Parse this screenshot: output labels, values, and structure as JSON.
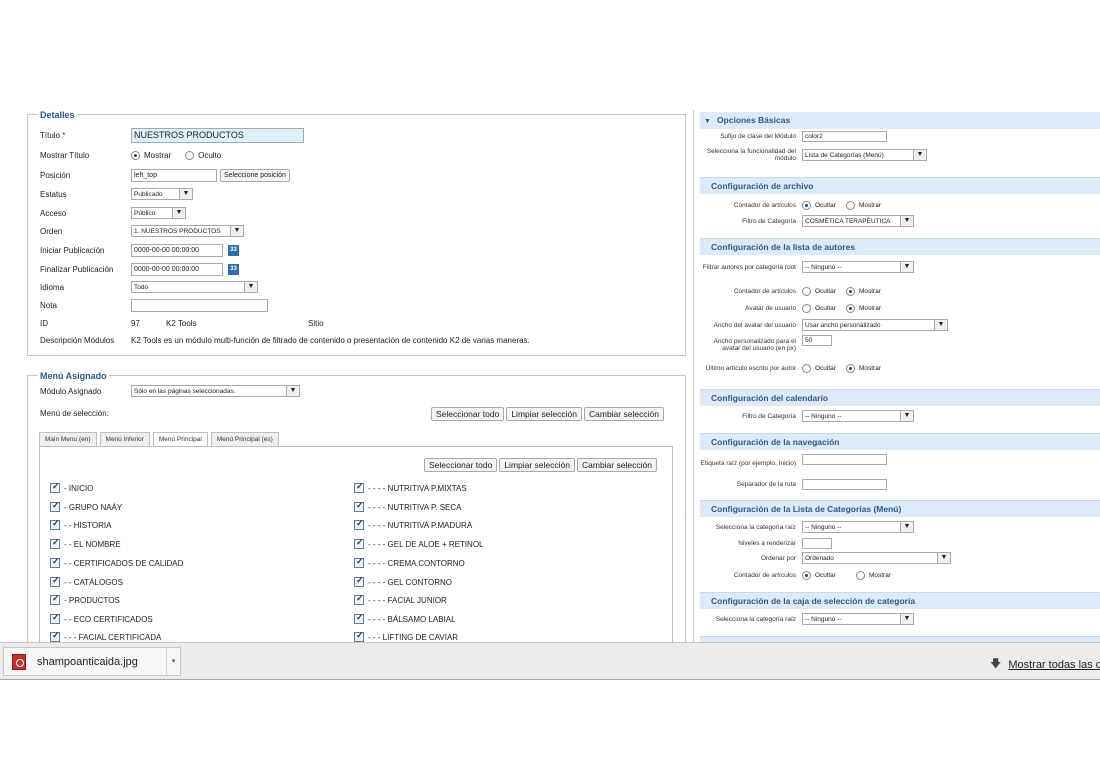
{
  "details": {
    "legend": "Detalles",
    "titulo_label": "Título",
    "titulo_req": "*",
    "titulo_value": "NUESTROS PRODUCTOS",
    "mostrar_titulo_label": "Mostrar Título",
    "mostrar_opt": "Mostrar",
    "oculto_opt": "Oculto",
    "posicion_label": "Posición",
    "posicion_value": "left_top",
    "posicion_button": "Seleccione posición",
    "estatus_label": "Estatus",
    "estatus_value": "Publicado",
    "acceso_label": "Acceso",
    "acceso_value": "Público",
    "orden_label": "Orden",
    "orden_value": "1. NUESTROS PRODUCTOS",
    "iniciar_label": "Iniciar Publicación",
    "iniciar_value": "0000-00-00 00:00:00",
    "finalizar_label": "Finalizar Publicación",
    "finalizar_value": "0000-00-00 00:00:00",
    "cal_icon_text": "33",
    "idioma_label": "Idioma",
    "idioma_value": "Todo",
    "nota_label": "Nota",
    "nota_value": "",
    "id_label": "ID",
    "id_value": "97",
    "module_type": "K2 Tools",
    "site": "Sitio",
    "desc_label": "Descripción Módulos",
    "desc_value": "K2 Tools es un módulo multi-función de filtrado de contenido o presentación de contenido K2 de varias maneras."
  },
  "menu": {
    "legend": "Menú Asignado",
    "modulo_label": "Módulo Asignado",
    "modulo_value": "Sólo en las páginas seleccionadas.",
    "seleccion_label": "Menú de selección:",
    "buttons": [
      "Seleccionar todo",
      "Limpiar selección",
      "Cambiar selección"
    ],
    "tabs": [
      "Main Menu (en)",
      "Menú Inferior",
      "Menú Principal",
      "Menú Principal (es)"
    ],
    "left_items": [
      "- INICIO",
      "- GRUPO NAÁY",
      "- - HISTORIA",
      "- - EL NOMBRE",
      "- - CERTIFICADOS DE CALIDAD",
      "- - CATÁLOGOS",
      "- PRODUCTOS",
      "- - ECO CERTIFICADOS",
      "- - - FACIAL CERTIFICADA"
    ],
    "right_items": [
      "- - - - NUTRITIVA P.MIXTAS",
      "- - - - NUTRITIVA P. SECA",
      "- - - - NUTRITIVA P.MADURA",
      "- - - - GEL DE ALOE + RETINOL",
      "- - - - CREMA CONTORNO",
      "- - - - GEL CONTORNO",
      "- - - - FACIAL JUNIOR",
      "- - - - BÁLSAMO LABIAL",
      "- - - LIFTING DE CAVIAR"
    ]
  },
  "right": {
    "opciones_basicas": "Opciones Básicas",
    "sufijo_label": "Sufijo de clase del Módulo",
    "sufijo_value": "color2",
    "funcionalidad_label": "Selecciona la funcionalidad del módulo",
    "funcionalidad_value": "Lista de Categorías (Menú)",
    "archivo_header": "Configuración de archivo",
    "contador_label": "Contador de artículos",
    "ocultar": "Ocultar",
    "mostrar": "Mostrar",
    "filtro_cat_label": "Filtro de Categoría",
    "filtro_cat_value": "COSMÉTICA TERAPÉUTICA",
    "autores_header": "Configuración de la lista de autores",
    "filtrar_autores_label": "Filtrar autores por categoría root",
    "ninguno": "-- Ninguno --",
    "avatar_label": "Avatar de usuario",
    "ancho_avatar_label": "Ancho del avatar del usuario",
    "ancho_avatar_value": "Usar ancho personalizado",
    "ancho_pers_label": "Ancho personalizado para el avatar del usuario (en px)",
    "ancho_pers_value": "50",
    "ultimo_label": "Último artículo escrito por autor",
    "calendario_header": "Configuración del calendario",
    "navegacion_header": "Configuración de la navegación",
    "etiqueta_raiz_label": "Etiqueta raíz (por ejemplo, Inicio)",
    "separador_label": "Separador de la ruta",
    "lista_cat_header": "Configuración de la Lista de Categorías (Menú)",
    "cat_raiz_label": "Selecciona la categoría raíz",
    "niveles_label": "Niveles a renderizar",
    "ordenar_label": "Ordenar por",
    "ordenar_value": "Ordenado",
    "caja_header": "Configuración de la caja de selección de categoría"
  },
  "downloads": {
    "file_name": "shampoanticaida.jpg",
    "show_all": "Mostrar todas las de"
  },
  "icons": {
    "collapse": "triangle-down-icon",
    "file": "pdf-file-icon",
    "download": "download-arrow-icon"
  },
  "colors": {
    "section_header_bg": "#deeaf7",
    "section_header_text": "#2c5a8c",
    "highlight_input": "#dff0fb"
  }
}
